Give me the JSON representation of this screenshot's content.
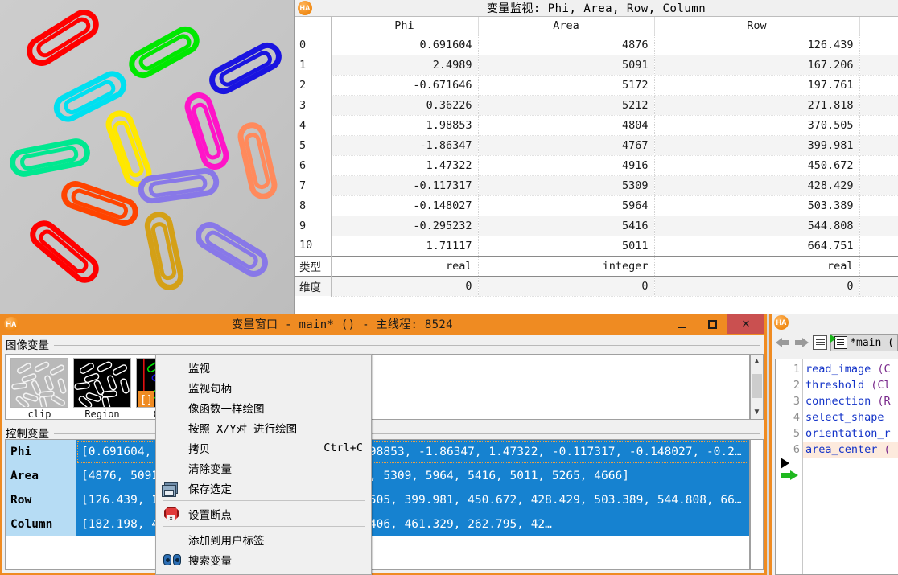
{
  "watch_window": {
    "logo": "HA",
    "title": "变量监视: Phi, Area, Row, Column",
    "columns": [
      "Phi",
      "Area",
      "Row"
    ],
    "index_labels": [
      "0",
      "1",
      "2",
      "3",
      "4",
      "5",
      "6",
      "7",
      "8",
      "9",
      "10"
    ],
    "rows": [
      {
        "idx": "0",
        "phi": "0.691604",
        "area": "4876",
        "row": "126.439"
      },
      {
        "idx": "1",
        "phi": "2.4989",
        "area": "5091",
        "row": "167.206"
      },
      {
        "idx": "2",
        "phi": "-0.671646",
        "area": "5172",
        "row": "197.761"
      },
      {
        "idx": "3",
        "phi": "0.36226",
        "area": "5212",
        "row": "271.818"
      },
      {
        "idx": "4",
        "phi": "1.98853",
        "area": "4804",
        "row": "370.505"
      },
      {
        "idx": "5",
        "phi": "-1.86347",
        "area": "4767",
        "row": "399.981"
      },
      {
        "idx": "6",
        "phi": "1.47322",
        "area": "4916",
        "row": "450.672"
      },
      {
        "idx": "7",
        "phi": "-0.117317",
        "area": "5309",
        "row": "428.429"
      },
      {
        "idx": "8",
        "phi": "-0.148027",
        "area": "5964",
        "row": "503.389"
      },
      {
        "idx": "9",
        "phi": "-0.295232",
        "area": "5416",
        "row": "544.808"
      },
      {
        "idx": "10",
        "phi": "1.71117",
        "area": "5011",
        "row": "664.751"
      }
    ],
    "footer": {
      "type_label": "类型",
      "dim_label": "维度",
      "types": {
        "phi": "real",
        "area": "integer",
        "row": "real"
      },
      "dims": {
        "phi": "0",
        "area": "0",
        "row": "0"
      }
    }
  },
  "var_window": {
    "logo": "HA",
    "title": "变量窗口 - main* () - 主线程: 8524",
    "minimize_label": "—",
    "maximize_label": "□",
    "close_label": "✕",
    "iconic_section": {
      "header": "图像变量",
      "thumbs": [
        {
          "label": "clip",
          "kind": "grayscale-clips"
        },
        {
          "label": "Region",
          "kind": "binary-regions"
        },
        {
          "label": "Conn",
          "kind": "colored-regions",
          "badge": "[ ]"
        }
      ]
    },
    "control_section": {
      "header": "控制变量",
      "rows": [
        {
          "name": "Phi",
          "value": "[0.691604, 2.4989, -0.671646, 0.36226, 1.98853, -1.86347, 1.47322, -0.117317, -0.148027, -0.2…"
        },
        {
          "name": "Area",
          "value": "[4876, 5091, 5172, 5212, 4804, 4767, 4916, 5309, 5964, 5416, 5011, 5265, 4666]"
        },
        {
          "name": "Row",
          "value": "[126.439, 167.206, 197.761, 271.818, 370.505, 399.981, 450.672, 428.429, 503.389, 544.808, 66…"
        },
        {
          "name": "Column",
          "value": "[182.198, 412.539, 339.445, 667.683, 131.406, 461.329, 262.795, 42…"
        }
      ]
    }
  },
  "context_menu": {
    "items": [
      {
        "label": "监视",
        "icon": "none",
        "accel": ""
      },
      {
        "label": "监视句柄",
        "icon": "none",
        "accel": ""
      },
      {
        "label": "像函数一样绘图",
        "icon": "none",
        "accel": ""
      },
      {
        "label": "按照 X/Y对 进行绘图",
        "icon": "none",
        "accel": ""
      },
      {
        "label": "拷贝",
        "icon": "none",
        "accel": "Ctrl+C"
      },
      {
        "label": "清除变量",
        "icon": "none",
        "accel": ""
      },
      {
        "label": "保存选定",
        "icon": "save-icon",
        "accel": ""
      },
      {
        "separator": true
      },
      {
        "label": "设置断点",
        "icon": "breakpoint-icon",
        "accel": ""
      },
      {
        "separator": true
      },
      {
        "label": "添加到用户标签",
        "icon": "none",
        "accel": ""
      },
      {
        "label": "搜索变量",
        "icon": "binoculars-icon",
        "accel": ""
      }
    ]
  },
  "code_window": {
    "logo": "HA",
    "tab_label": "*main (",
    "lines": [
      {
        "no": "1",
        "text": "read_image (C",
        "highlight": false
      },
      {
        "no": "2",
        "text": "threshold (Cl",
        "highlight": false
      },
      {
        "no": "3",
        "text": "connection (R",
        "highlight": false
      },
      {
        "no": "4",
        "text": "select_shape",
        "highlight": false
      },
      {
        "no": "5",
        "text": "orientation_r",
        "highlight": false
      },
      {
        "no": "6",
        "text": "area_center (",
        "highlight": true
      }
    ]
  },
  "colors": {
    "accent_orange": "#ef8b22",
    "selection_blue": "#1682d0",
    "selection_light": "#b6dcf4",
    "code_keyword": "#1333c8",
    "close_red": "#ca5050"
  },
  "image_window": {
    "description": "paper-clips-grayscale-with-colored-region-overlays",
    "clip_colors": [
      "#ff0000",
      "#00e800",
      "#1a14e0",
      "#00e8f0",
      "#ff14c8",
      "#ff8040",
      "#00e890",
      "#ffe800",
      "#8878e8",
      "#ff4400",
      "#ff0000",
      "#d4a017",
      "#8878e8"
    ]
  }
}
